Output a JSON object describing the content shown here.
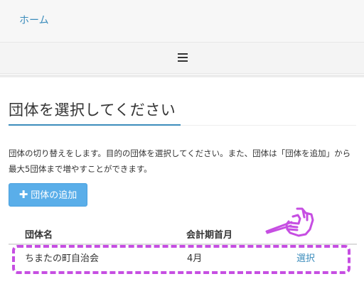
{
  "navbar": {
    "home_label": "ホーム"
  },
  "menu": {
    "icon": "hamburger-menu-icon"
  },
  "page": {
    "title": "団体を選択してください",
    "description": "団体の切り替えをします。目的の団体を選択してください。また、団体は「団体を追加」から最大5団体まで増やすことができます。",
    "add_button": {
      "icon": "plus-icon",
      "label": "団体の追加"
    }
  },
  "table": {
    "headers": {
      "name": "団体名",
      "fiscal_month": "会計期首月"
    },
    "rows": [
      {
        "name": "ちまたの町自治会",
        "fiscal_month": "4月",
        "action": "選択"
      }
    ]
  },
  "annotation": {
    "icon": "pointing-hand-icon",
    "highlight_color": "#c64ee2"
  },
  "colors": {
    "accent": "#3c8dbc",
    "button": "#5aaee9",
    "highlight": "#c64ee2"
  }
}
